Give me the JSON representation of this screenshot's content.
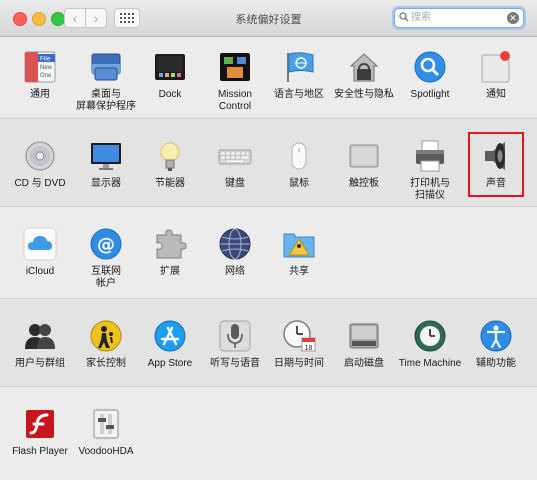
{
  "window": {
    "title": "系统偏好设置"
  },
  "toolbar": {
    "back_label": "‹",
    "forward_label": "›"
  },
  "search": {
    "placeholder": "搜索",
    "value": "",
    "clear_label": "✕"
  },
  "sections": {
    "row1": [
      "通用",
      "桌面与\n屏幕保护程序",
      "Dock",
      "Mission\nControl",
      "语言与地区",
      "安全性与隐私",
      "Spotlight",
      "通知"
    ],
    "row2": [
      "CD 与 DVD",
      "显示器",
      "节能器",
      "键盘",
      "鼠标",
      "触控板",
      "打印机与\n扫描仪",
      "声音"
    ],
    "row3": [
      "iCloud",
      "互联网\n帐户",
      "扩展",
      "网络",
      "共享"
    ],
    "row4": [
      "用户与群组",
      "家长控制",
      "App Store",
      "听写与语音",
      "日期与时间",
      "启动磁盘",
      "Time Machine",
      "辅助功能"
    ],
    "row5": [
      "Flash Player",
      "VoodooHDA"
    ]
  },
  "icon_labels": {
    "general_file": "File",
    "general_new": "New",
    "general_one": "One",
    "date_day": "18"
  },
  "accent": {
    "highlight": "#e0161c",
    "search_focus": "#a8c7f0"
  }
}
